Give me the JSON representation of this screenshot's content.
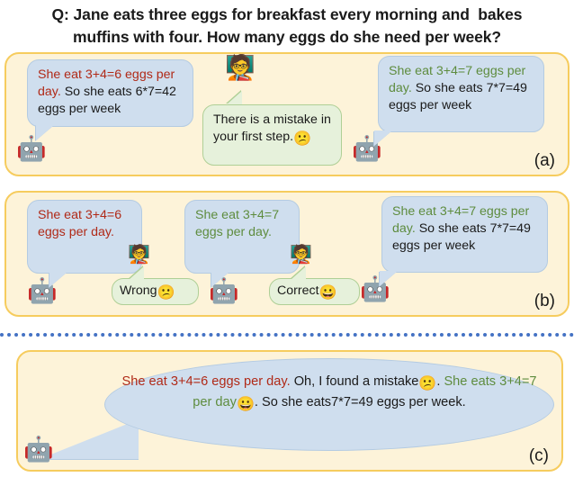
{
  "question": {
    "line1": "Q: Jane eats three eggs for breakfast every morning and  bakes",
    "line2": "muffins with four. How many eggs do she need per week?"
  },
  "colors": {
    "panel_bg": "#FDF3D9",
    "panel_border": "#F6CC5E",
    "bubble_blue_bg": "#CFDEEE",
    "bubble_blue_border": "#B4CBE2",
    "bubble_green_bg": "#E6F1DB",
    "bubble_green_border": "#AFCF96",
    "wrong_text": "#B02A18",
    "correct_text": "#5E8C3E",
    "divider": "#4472C4"
  },
  "icons": {
    "robot": "🤖",
    "teacher": "🧑‍🏫",
    "confused_face": "😕",
    "grinning_face": "😀"
  },
  "panel_a": {
    "label": "(a)",
    "bubble1": {
      "wrong_part": "She eat 3+4=6 eggs per day.",
      "rest": " So she eats 6*7=42 eggs per week"
    },
    "bubble2": {
      "text": "There is a mistake in your first step."
    },
    "bubble3": {
      "correct_part": "She eat 3+4=7 eggs per day.",
      "rest": " So she eats 7*7=49 eggs per week"
    }
  },
  "panel_b": {
    "label": "(b)",
    "bubble1": {
      "wrong_part": "She eat 3+4=6 eggs per day."
    },
    "feedback1": {
      "text": "Wrong"
    },
    "bubble2": {
      "correct_part": "She eat 3+4=7 eggs per day."
    },
    "feedback2": {
      "text": "Correct"
    },
    "bubble3": {
      "correct_part": "She eat 3+4=7 eggs per day.",
      "rest": " So she eats 7*7=49 eggs per week"
    }
  },
  "panel_c": {
    "label": "(c)",
    "bubble": {
      "wrong_part": "She eat 3+4=6 eggs per day.",
      "mid1": " Oh, I found a mistake",
      "mid2": ". ",
      "correct_part": "She eats 3+4=7 per day",
      "mid3": ". So she eats7*7=49 eggs per week."
    }
  }
}
